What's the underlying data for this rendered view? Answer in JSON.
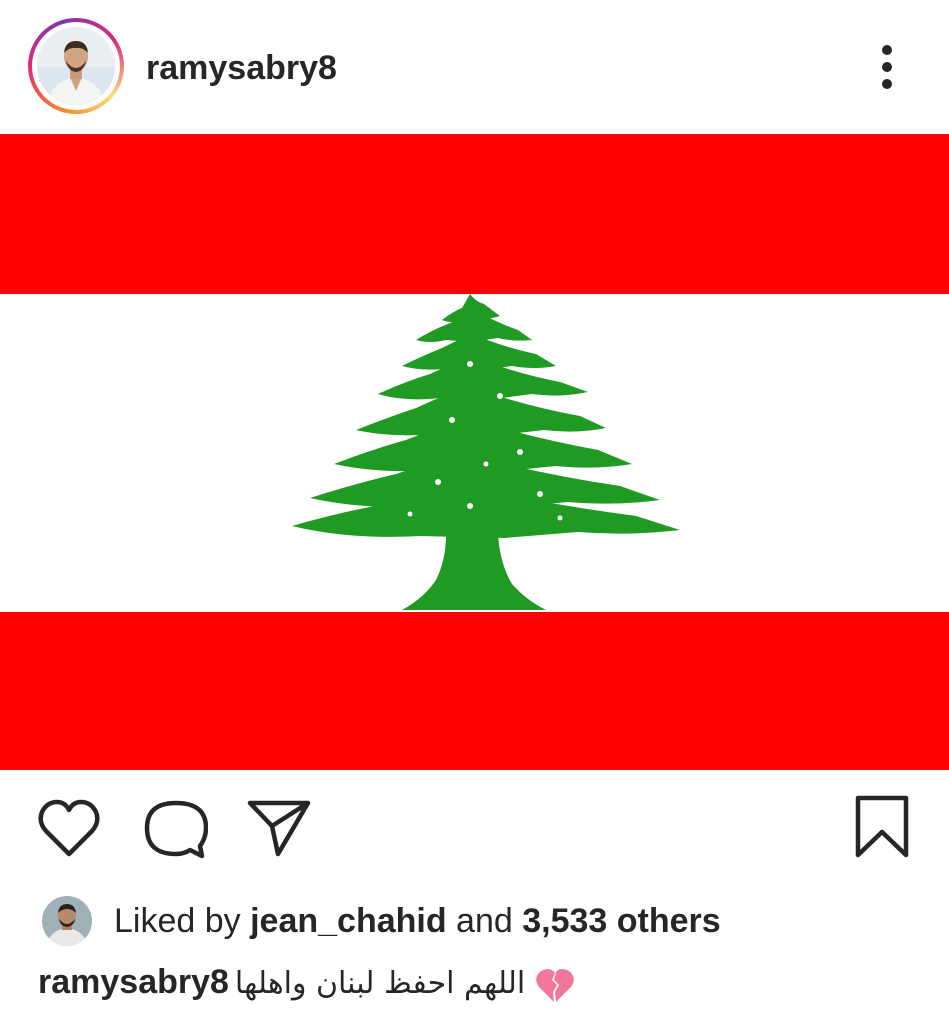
{
  "post": {
    "author": {
      "username": "ramysabry8",
      "avatar_icon": "profile-photo-icon",
      "story_ring": true
    },
    "menu_icon": "more-vertical-icon",
    "image": {
      "description_icon": "lebanese-flag-icon",
      "colors": {
        "red": "#fe0000",
        "white": "#ffffff",
        "green": "#1f9a22"
      }
    },
    "actions": {
      "like_icon": "heart-outline-icon",
      "comment_icon": "comment-bubble-icon",
      "share_icon": "paper-plane-icon",
      "save_icon": "bookmark-outline-icon"
    },
    "likes": {
      "prefix": "Liked by ",
      "first_liker": "jean_chahid",
      "connector": " and ",
      "others_count": "3,533 others",
      "liker_avatar_icon": "liker-profile-photo-icon"
    },
    "caption": {
      "username": "ramysabry8",
      "text": "اللهم احفظ لبنان واهلها",
      "emoji_icon": "broken-heart-icon"
    }
  }
}
